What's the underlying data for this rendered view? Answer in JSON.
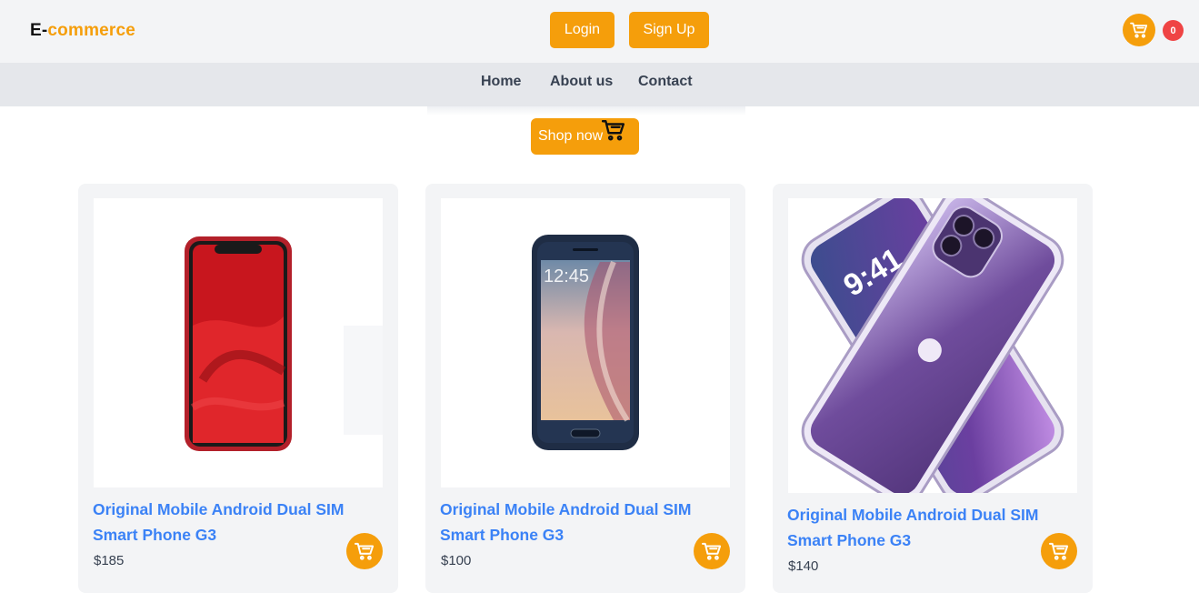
{
  "brand": {
    "part1": "E-",
    "part2": "commerce"
  },
  "auth": {
    "login_label": "Login",
    "signup_label": "Sign Up"
  },
  "cart": {
    "count": "0"
  },
  "nav": {
    "items": [
      {
        "label": "Home"
      },
      {
        "label": "About us"
      },
      {
        "label": "Contact"
      }
    ]
  },
  "hero": {
    "shop_label": "Shop now"
  },
  "colors": {
    "accent": "#f59e0b",
    "link": "#3b82f6",
    "badge": "#ef4444",
    "topbar": "#f3f4f6",
    "navbar": "#e5e7eb"
  },
  "products": [
    {
      "title": "Original Mobile Android Dual SIM Smart Phone G3",
      "price": "$185",
      "image": "red-phone"
    },
    {
      "title": "Original Mobile Android Dual SIM Smart Phone G3",
      "price": "$100",
      "image": "blue-android-phone"
    },
    {
      "title": "Original Mobile Android Dual SIM Smart Phone G3",
      "price": "$140",
      "image": "purple-iphone-case"
    }
  ]
}
